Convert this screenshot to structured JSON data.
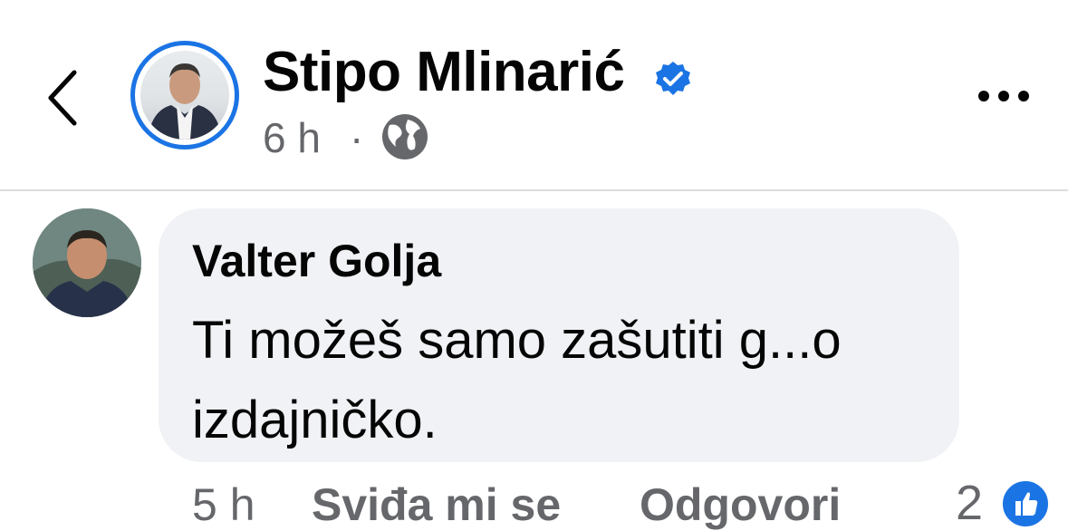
{
  "post": {
    "author_name": "Stipo Mlinarić",
    "time": "6 h",
    "separator": "·",
    "verified_icon": "verified-badge-icon",
    "audience_icon": "globe-icon",
    "more_icon": "more-options-icon",
    "back_icon": "chevron-left-icon"
  },
  "comment": {
    "author_name": "Valter Golja",
    "text": "Ti možeš samo zašutiti g...o izdajničko.",
    "actions": {
      "time": "5 h",
      "like_label": "Sviđa mi se",
      "reply_label": "Odgovori"
    },
    "reaction_count": "2",
    "reaction_icon": "like-thumb-icon"
  },
  "colors": {
    "accent": "#1b74e4",
    "secondary_text": "#65676b",
    "bubble_bg": "#f0f2f5"
  }
}
